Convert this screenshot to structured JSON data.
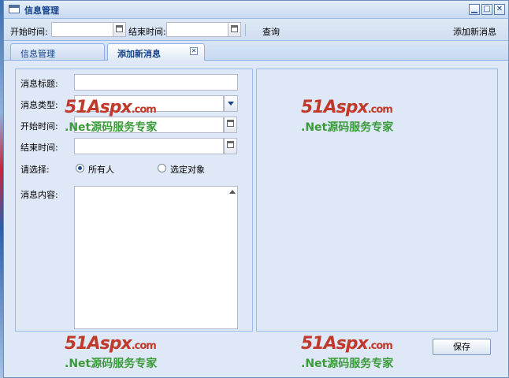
{
  "window": {
    "title": "信息管理",
    "buttons": {
      "minimize": "▁",
      "maximize": "□",
      "close": "✕"
    }
  },
  "toolbar": {
    "start_label": "开始时间:",
    "start_value": "",
    "end_label": "结束时间:",
    "end_value": "",
    "query_label": "查询",
    "add_label": "添加新消息"
  },
  "tabs": [
    {
      "label": "信息管理",
      "active": false
    },
    {
      "label": "添加新消息",
      "active": true,
      "closable": true
    }
  ],
  "form": {
    "title_label": "消息标题:",
    "title_value": "",
    "type_label": "消息类型:",
    "type_value": "",
    "start_label": "开始时间:",
    "start_value": "",
    "end_label": "结束时间:",
    "end_value": "",
    "choose_label": "请选择:",
    "radio_all": "所有人",
    "radio_selected": "选定对象",
    "content_label": "消息内容:",
    "content_value": ""
  },
  "watermark": {
    "logo_main": "51Aspx",
    "logo_suffix": ".com",
    "subtitle": ".Net源码服务专家"
  },
  "save_label": "保存"
}
